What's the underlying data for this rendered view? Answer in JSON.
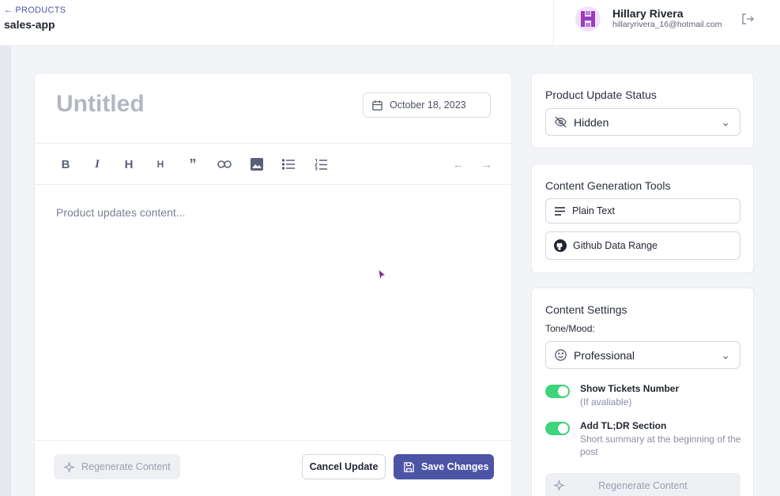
{
  "header": {
    "back_label": "PRODUCTS",
    "app_name": "sales-app",
    "user_name": "Hillary Rivera",
    "user_email": "hillaryrivera_16@hotmail.com"
  },
  "editor": {
    "title_placeholder": "Untitled",
    "date": "October 18, 2023",
    "content_placeholder": "Product updates content...",
    "toolbar": [
      "bold-icon",
      "italic-icon",
      "heading-1-icon",
      "heading-2-icon",
      "quote-icon",
      "link-icon",
      "image-icon",
      "bullet-list-icon",
      "numbered-list-icon",
      "undo-icon",
      "redo-icon"
    ],
    "regenerate_label": "Regenerate Content",
    "cancel_label": "Cancel Update",
    "save_label": "Save Changes"
  },
  "status_card": {
    "title": "Product Update Status",
    "selected": "Hidden"
  },
  "tools_card": {
    "title": "Content Generation Tools",
    "plain_text": "Plain Text",
    "github": "Github Data Range"
  },
  "settings_card": {
    "title": "Content Settings",
    "tone_label": "Tone/Mood:",
    "tone_selected": "Professional",
    "toggles": [
      {
        "title": "Show Tickets Number",
        "subtitle": "(If avaliable)",
        "on": true
      },
      {
        "title": "Add TL;DR Section",
        "subtitle": "Short summary at the beginning of the post",
        "on": true
      }
    ],
    "regenerate_label": "Regenerate Content"
  },
  "colors": {
    "accent": "#4c54a6",
    "toggle_on": "#3dd47a",
    "avatar": "#9b3dbf"
  }
}
